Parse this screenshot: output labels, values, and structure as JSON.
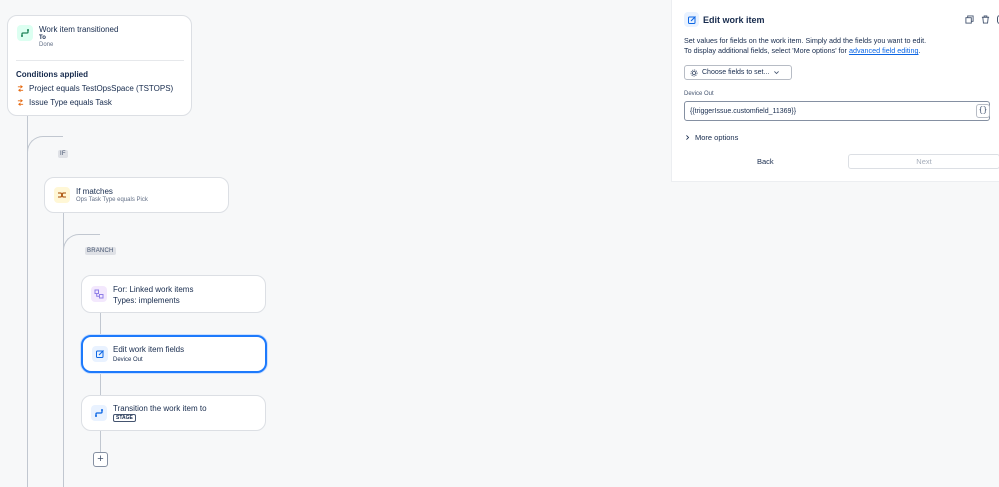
{
  "trigger": {
    "title": "Work item transitioned",
    "to_label": "To",
    "to_value": "Done",
    "conditions_heading": "Conditions applied",
    "conditions": [
      "Project equals TestOpsSpace (TSTOPS)",
      "Issue Type equals Task"
    ]
  },
  "if_tag": "IF",
  "if_node": {
    "title": "If matches",
    "subtitle": "Ops Task Type equals Pick"
  },
  "branch_tag": "BRANCH",
  "for_node": {
    "title": "For: Linked work items",
    "subtitle": "Types: implements"
  },
  "edit_node": {
    "title": "Edit work item fields",
    "subtitle": "Device Out"
  },
  "transition_node": {
    "title": "Transition the work item to",
    "stage_tag": "STAGE"
  },
  "add_button": "+",
  "panel": {
    "title": "Edit work item",
    "desc_line1": "Set values for fields on the work item. Simply add the fields you want to edit.",
    "desc_line2_prefix": "To display additional fields, select 'More options' for ",
    "desc_link": "advanced field editing",
    "desc_line2_suffix": ".",
    "choose_fields": "Choose fields to set...",
    "field_label": "Device Out",
    "field_value": "{{triggerIssue.customfield_11369}}",
    "brace_button": "{}",
    "more_options": "More options",
    "back": "Back",
    "next": "Next"
  },
  "colors": {
    "accent": "#1d7afc",
    "trigger_icon_bg": "#dcfff1",
    "if_icon_bg": "#fff7d6",
    "for_icon_bg": "#f3e8fd",
    "action_icon_bg": "#e9f2ff",
    "condition_icon": "#e56910"
  }
}
